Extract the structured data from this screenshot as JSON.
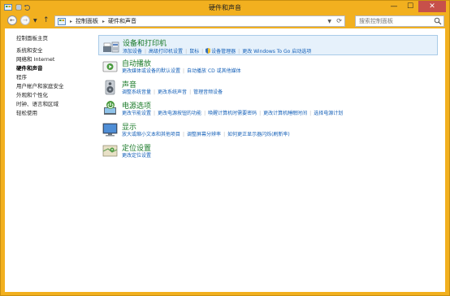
{
  "window": {
    "title": "硬件和声音",
    "controls": {
      "minimize": "—",
      "maximize": "☐",
      "close": "✕"
    }
  },
  "nav": {
    "back": "←",
    "forward": "→",
    "up": "↑",
    "breadcrumb": [
      "控制面板",
      "硬件和声音"
    ],
    "search_placeholder": "搜索控制面板"
  },
  "sidebar": {
    "items": [
      {
        "label": "控制面板主页",
        "current": false
      },
      {
        "label": "系统和安全",
        "current": false
      },
      {
        "label": "网络和 Internet",
        "current": false
      },
      {
        "label": "硬件和声音",
        "current": true
      },
      {
        "label": "程序",
        "current": false
      },
      {
        "label": "用户帐户和家庭安全",
        "current": false
      },
      {
        "label": "外观和个性化",
        "current": false
      },
      {
        "label": "时钟、语言和区域",
        "current": false
      },
      {
        "label": "轻松使用",
        "current": false
      }
    ]
  },
  "categories": [
    {
      "title": "设备和打印机",
      "icon": "printer-icon",
      "links": [
        "添加设备",
        "高级打印机设置",
        "鼠标",
        "设备管理器",
        "更改 Windows To Go 启动选项"
      ]
    },
    {
      "title": "自动播放",
      "icon": "autoplay-icon",
      "links": [
        "更改媒体或设备的默认设置",
        "自动播放 CD 或其他媒体"
      ]
    },
    {
      "title": "声音",
      "icon": "speaker-icon",
      "links": [
        "调整系统音量",
        "更改系统声音",
        "管理音频设备"
      ]
    },
    {
      "title": "电源选项",
      "icon": "power-icon",
      "links": [
        "更改节能设置",
        "更改电源按钮的功能",
        "唤醒计算机时需要密码",
        "更改计算机睡眠时间",
        "选择电源计划"
      ]
    },
    {
      "title": "显示",
      "icon": "display-icon",
      "links": [
        "放大或缩小文本和其他项目",
        "调整屏幕分辨率",
        "如何更正显示器闪烁(刷新率)"
      ]
    },
    {
      "title": "定位设置",
      "icon": "location-icon",
      "links": [
        "更改定位设置"
      ]
    }
  ],
  "colors": {
    "frame": "#f2b01f",
    "category_title": "#1a7a28",
    "link": "#1560b8",
    "close_button": "#c7504a",
    "highlight": "#e6f1fb"
  }
}
